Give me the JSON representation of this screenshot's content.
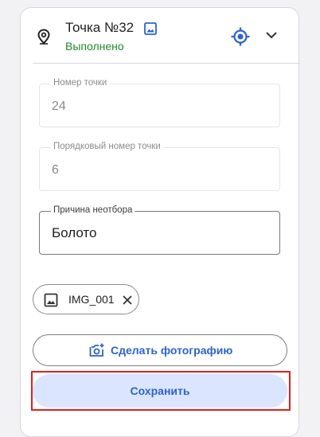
{
  "header": {
    "title": "Точка №32",
    "status": "Выполнено",
    "icons": [
      "location-pin-icon",
      "image-icon",
      "target-location-icon",
      "chevron-down-icon"
    ]
  },
  "fields": [
    {
      "label": "Номер точки",
      "value": "24"
    },
    {
      "label": "Порядковый номер точки",
      "value": "6"
    },
    {
      "label": "Причина неотбора",
      "value": "Болото"
    }
  ],
  "attachment": {
    "filename": "IMG_001",
    "icons": [
      "image-icon",
      "close-icon"
    ]
  },
  "actions": {
    "take_photo_label": "Сделать фотографию",
    "save_label": "Сохранить"
  },
  "colors": {
    "accent": "#2d64c8",
    "status_green": "#1f8a2a",
    "save_bg": "#dbe5ff",
    "highlight_red": "#e02020"
  }
}
